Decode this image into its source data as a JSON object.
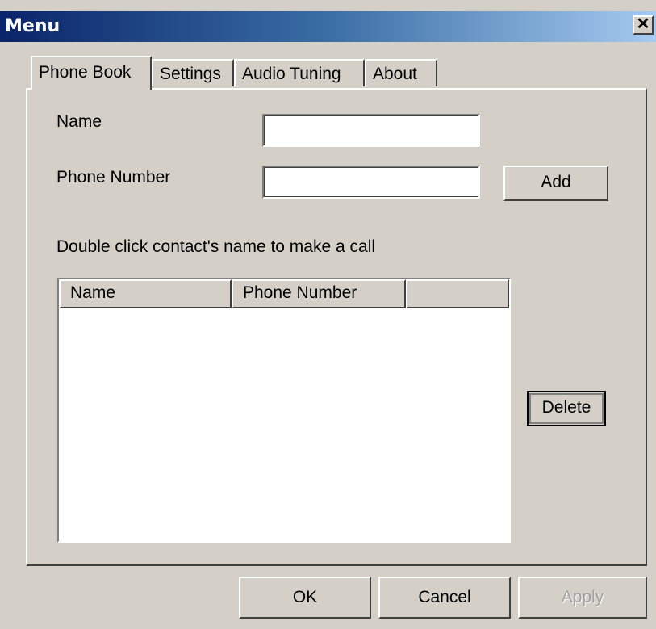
{
  "window": {
    "title": "Menu"
  },
  "tabs": [
    {
      "label": "Phone Book"
    },
    {
      "label": "Settings"
    },
    {
      "label": "Audio Tuning"
    },
    {
      "label": "About"
    }
  ],
  "form": {
    "name_label": "Name",
    "name_value": "",
    "phone_label": "Phone Number",
    "phone_value": "",
    "add_label": "Add"
  },
  "instruction": "Double click contact's name to make a call",
  "contacts": {
    "columns": [
      "Name",
      "Phone Number",
      ""
    ],
    "rows": []
  },
  "delete_label": "Delete",
  "footer": {
    "ok": "OK",
    "cancel": "Cancel",
    "apply": "Apply"
  }
}
